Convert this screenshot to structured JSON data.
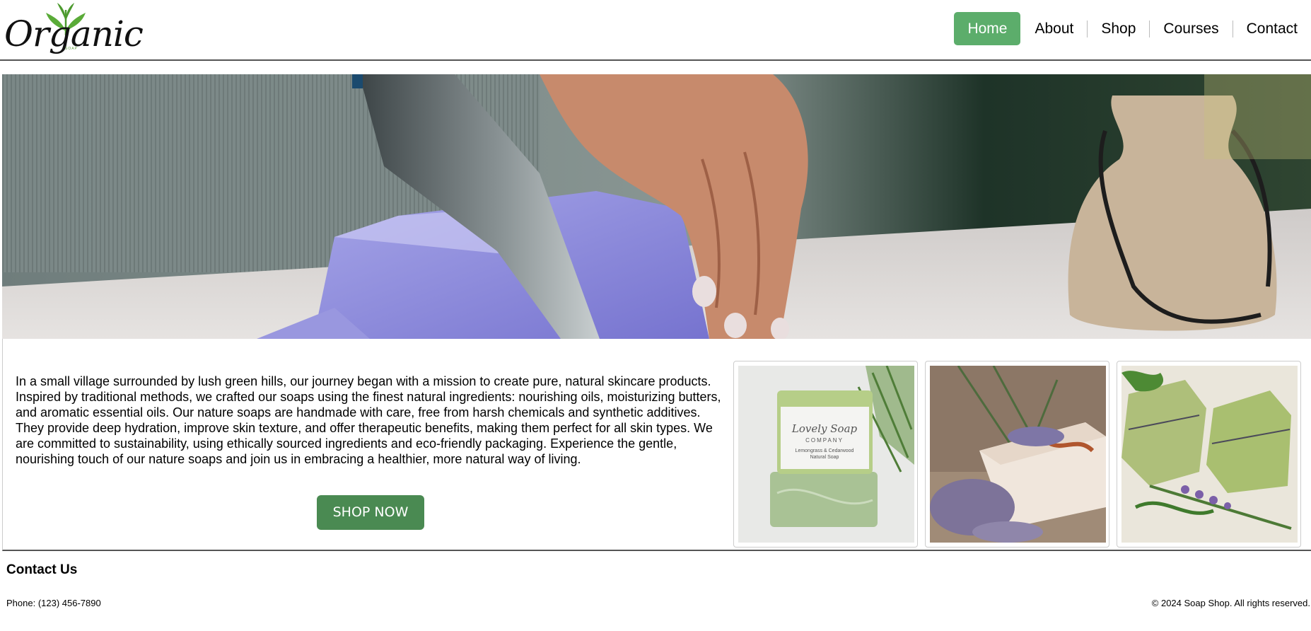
{
  "header": {
    "logo": {
      "word": "Organic",
      "tag": "SOAP"
    },
    "nav": [
      {
        "label": "Home",
        "active": true
      },
      {
        "label": "About",
        "active": false
      },
      {
        "label": "Shop",
        "active": false
      },
      {
        "label": "Courses",
        "active": false
      },
      {
        "label": "Contact",
        "active": false
      }
    ]
  },
  "hero": {
    "image": "hand-cutting-lavender-soap-photo"
  },
  "main": {
    "about_text": "In a small village surrounded by lush green hills, our journey began with a mission to create pure, natural skincare products. Inspired by traditional methods, we crafted our soaps using the finest natural ingredients: nourishing oils, moisturizing butters, and aromatic essential oils. Our nature soaps are handmade with care, free from harsh chemicals and synthetic additives. They provide deep hydration, improve skin texture, and offer therapeutic benefits, making them perfect for all skin types. We are committed to sustainability, using ethically sourced ingredients and eco-friendly packaging. Experience the gentle, nourishing touch of our nature soaps and join us in embracing a healthier, more natural way of living.",
    "shop_button": "SHOP NOW",
    "gallery": [
      {
        "image": "lemongrass-soap-photo",
        "label_lines": [
          "Lovely Soap",
          "COMPANY",
          "Lemongrass & Cedarwood",
          "Natural Soap"
        ]
      },
      {
        "image": "lavender-soap-photo"
      },
      {
        "image": "green-herbal-soap-photo"
      }
    ]
  },
  "footer": {
    "heading": "Contact Us",
    "phone": "Phone: (123) 456-7890",
    "copyright": "© 2024 Soap Shop. All rights reserved."
  },
  "colors": {
    "nav_active": "#5cad6b",
    "shop_button": "#4a8a52",
    "logo_leaf": "#5a9a3a"
  }
}
